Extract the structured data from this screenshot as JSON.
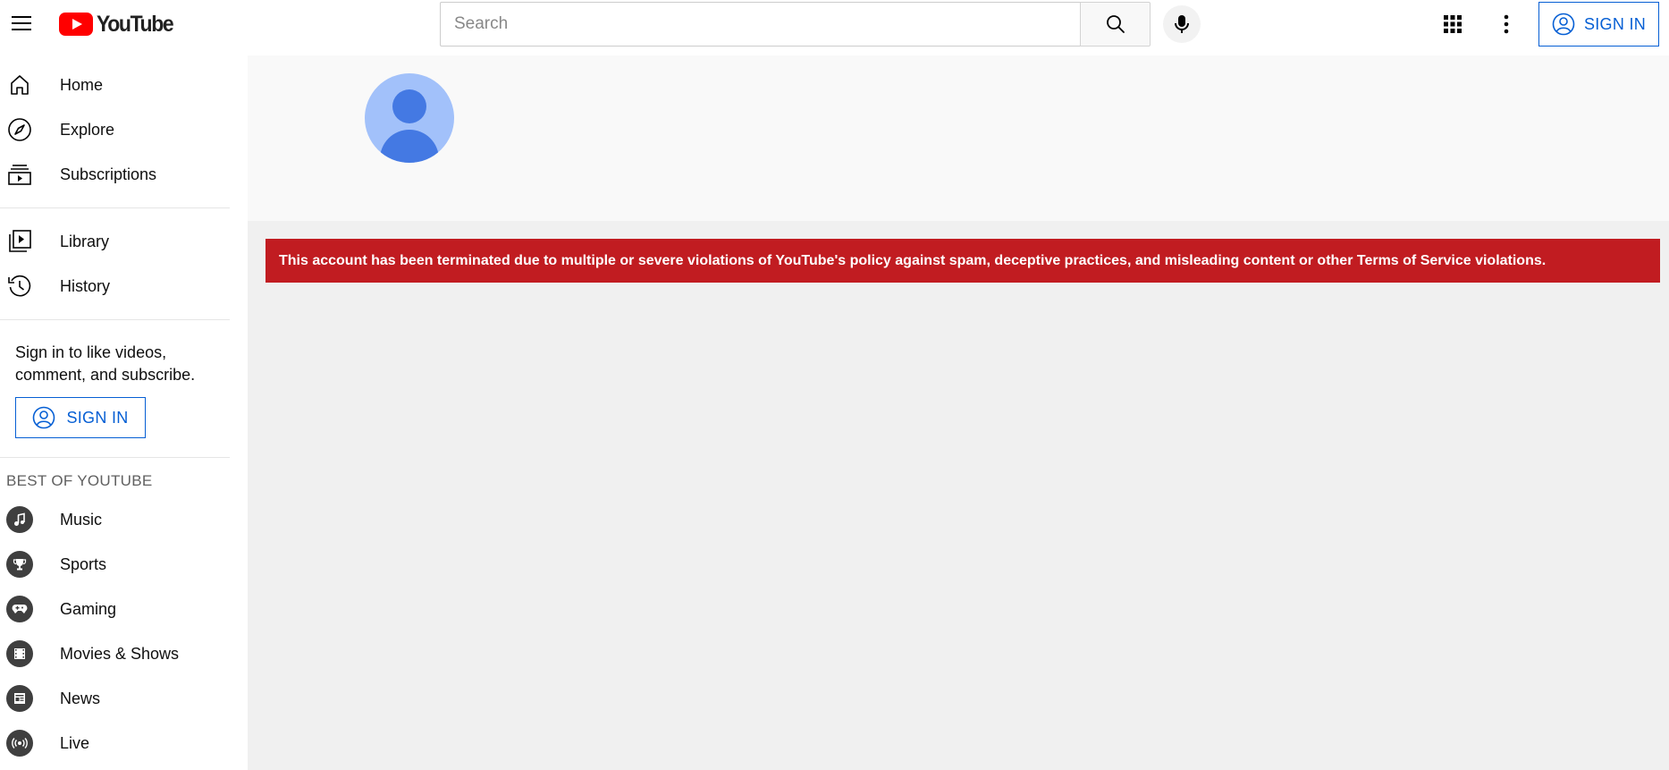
{
  "header": {
    "logo_text": "YouTube",
    "search_placeholder": "Search",
    "sign_in_label": "SIGN IN"
  },
  "sidebar": {
    "primary": [
      {
        "label": "Home",
        "icon": "home-icon"
      },
      {
        "label": "Explore",
        "icon": "compass-icon"
      },
      {
        "label": "Subscriptions",
        "icon": "subscriptions-icon"
      }
    ],
    "secondary": [
      {
        "label": "Library",
        "icon": "library-icon"
      },
      {
        "label": "History",
        "icon": "history-icon"
      }
    ],
    "sign_in_prompt": "Sign in to like videos, comment, and subscribe.",
    "sign_in_label": "SIGN IN",
    "best_of_title": "BEST OF YOUTUBE",
    "best_of": [
      {
        "label": "Music",
        "icon": "music-icon"
      },
      {
        "label": "Sports",
        "icon": "trophy-icon"
      },
      {
        "label": "Gaming",
        "icon": "gamepad-icon"
      },
      {
        "label": "Movies & Shows",
        "icon": "film-icon"
      },
      {
        "label": "News",
        "icon": "newspaper-icon"
      },
      {
        "label": "Live",
        "icon": "live-icon"
      }
    ]
  },
  "main": {
    "termination_notice": "This account has been terminated due to multiple or severe violations of YouTube's policy against spam, deceptive practices, and misleading content or other Terms of Service violations."
  },
  "colors": {
    "brand_red": "#ff0000",
    "link_blue": "#065fd4",
    "alert_red": "#c11c21",
    "avatar_light": "#a2c1fa",
    "avatar_dark": "#4479e3"
  }
}
